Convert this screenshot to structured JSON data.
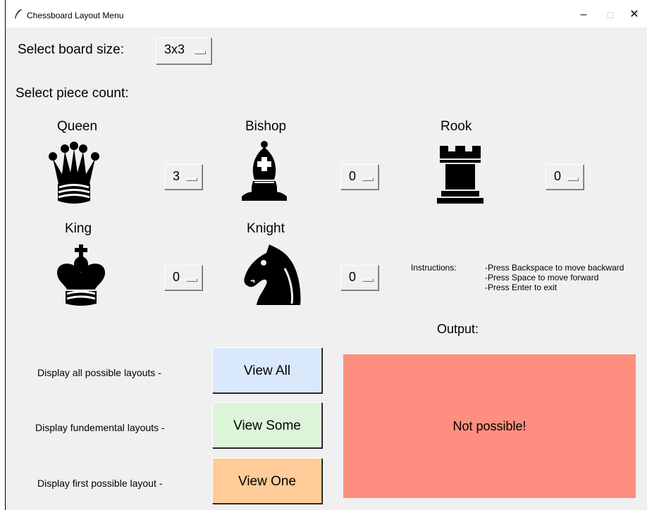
{
  "window": {
    "title": "Chessboard Layout Menu",
    "minimize": "–",
    "maximize": "□",
    "close": "✕"
  },
  "board_size": {
    "label": "Select board size:",
    "value": "3x3"
  },
  "piece_count": {
    "label": "Select piece count:",
    "pieces": [
      {
        "name": "Queen",
        "count": "3",
        "icon": "queen-icon"
      },
      {
        "name": "Bishop",
        "count": "0",
        "icon": "bishop-icon"
      },
      {
        "name": "Rook",
        "count": "0",
        "icon": "rook-icon"
      },
      {
        "name": "King",
        "count": "0",
        "icon": "king-icon"
      },
      {
        "name": "Knight",
        "count": "0",
        "icon": "knight-icon"
      }
    ]
  },
  "instructions": {
    "label": "Instructions:",
    "lines": [
      "-Press Backspace to move backward",
      "-Press Space to move forward",
      "-Press Enter to exit"
    ]
  },
  "actions": [
    {
      "description": "Display all possible layouts -",
      "button": "View All",
      "color": "#dae8fc"
    },
    {
      "description": "Display fundemental layouts -",
      "button": "View Some",
      "color": "#dcf5d9"
    },
    {
      "description": "Display first possible layout -",
      "button": "View One",
      "color": "#ffcc99"
    }
  ],
  "output": {
    "label": "Output:",
    "text": "Not possible!",
    "color": "#fe8e7f"
  }
}
